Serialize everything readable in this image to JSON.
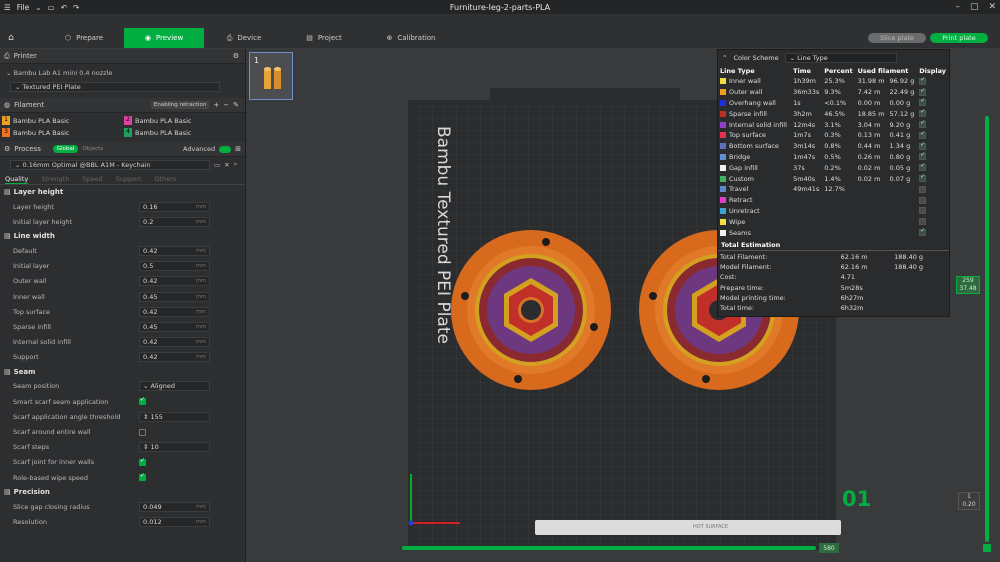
{
  "titlebar": {
    "menu_label": "File",
    "title": "Furniture-leg-2-parts-PLA"
  },
  "topbar": {
    "tabs": [
      {
        "label": "Prepare"
      },
      {
        "label": "Preview"
      },
      {
        "label": "Device"
      },
      {
        "label": "Project"
      },
      {
        "label": "Calibration"
      }
    ],
    "slice_label": "Slice plate",
    "print_label": "Print plate"
  },
  "printer": {
    "section_label": "Printer",
    "name": "Bambu Lab A1 mini 0.4 nozzle",
    "plate": "Textured PEI Plate"
  },
  "filament": {
    "section_label": "Filament",
    "badge": "Enabling retraction",
    "slots": [
      {
        "num": "1",
        "name": "Bambu PLA Basic",
        "color": "#f0a020"
      },
      {
        "num": "2",
        "name": "Bambu PLA Basic",
        "color": "#e040a0"
      },
      {
        "num": "3",
        "name": "Bambu PLA Basic",
        "color": "#f07020"
      },
      {
        "num": "4",
        "name": "Bambu PLA Basic",
        "color": "#20a060"
      }
    ]
  },
  "process": {
    "section_label": "Process",
    "global_label": "Global",
    "objects_label": "Objects",
    "advanced_label": "Advanced",
    "preset": "0.16mm Optimal @BBL A1M - Keychain",
    "tabs": [
      "Quality",
      "Strength",
      "Speed",
      "Support",
      "Others"
    ]
  },
  "quality": {
    "layer_height_group": "Layer height",
    "layer_height_label": "Layer height",
    "layer_height": "0.16",
    "initial_layer_height_label": "Initial layer height",
    "initial_layer_height": "0.2",
    "line_width_group": "Line width",
    "default_label": "Default",
    "default": "0.42",
    "initial_layer_label": "Initial layer",
    "initial_layer": "0.5",
    "outer_wall_label": "Outer wall",
    "outer_wall": "0.42",
    "inner_wall_label": "Inner wall",
    "inner_wall": "0.45",
    "top_surface_label": "Top surface",
    "top_surface": "0.42",
    "sparse_infill_label": "Sparse infill",
    "sparse_infill": "0.45",
    "internal_solid_infill_label": "Internal solid infill",
    "internal_solid_infill": "0.42",
    "support_label": "Support",
    "support": "0.42",
    "seam_group": "Seam",
    "seam_position_label": "Seam position",
    "seam_position": "Aligned",
    "smart_scarf_label": "Smart scarf seam application",
    "scarf_angle_label": "Scarf application angle threshold",
    "scarf_angle": "155",
    "scarf_around_label": "Scarf around entire wall",
    "scarf_steps_label": "Scarf steps",
    "scarf_steps": "10",
    "scarf_inner_label": "Scarf joint for inner walls",
    "role_wipe_label": "Role-based wipe speed",
    "precision_group": "Precision",
    "slice_gap_label": "Slice gap closing radius",
    "slice_gap": "0.049",
    "resolution_label": "Resolution",
    "resolution": "0.012",
    "unit": "mm"
  },
  "plate": {
    "thumb_num": "1",
    "bed_text": "Bambu Textured PEI Plate"
  },
  "legend": {
    "color_scheme_label": "Color Scheme",
    "color_scheme_value": "Line Type",
    "headers": [
      "Line Type",
      "Time",
      "Percent",
      "Used filament",
      "",
      "Display"
    ],
    "rows": [
      {
        "name": "Inner wall",
        "color": "#f0dc3c",
        "time": "1h39m",
        "pct": "25.3%",
        "len": "31.98 m",
        "g": "96.92 g",
        "on": true
      },
      {
        "name": "Outer wall",
        "color": "#f0a020",
        "time": "36m33s",
        "pct": "9.3%",
        "len": "7.42 m",
        "g": "22.49 g",
        "on": true
      },
      {
        "name": "Overhang wall",
        "color": "#2030d8",
        "time": "1s",
        "pct": "<0.1%",
        "len": "0.00 m",
        "g": "0.00 g",
        "on": true
      },
      {
        "name": "Sparse infill",
        "color": "#c03020",
        "time": "3h2m",
        "pct": "46.5%",
        "len": "18.85 m",
        "g": "57.12 g",
        "on": true
      },
      {
        "name": "Internal solid infill",
        "color": "#9040c8",
        "time": "12m4s",
        "pct": "3.1%",
        "len": "3.04 m",
        "g": "9.20 g",
        "on": true
      },
      {
        "name": "Top surface",
        "color": "#e83050",
        "time": "1m7s",
        "pct": "0.3%",
        "len": "0.13 m",
        "g": "0.41 g",
        "on": true
      },
      {
        "name": "Bottom surface",
        "color": "#6070b8",
        "time": "3m14s",
        "pct": "0.8%",
        "len": "0.44 m",
        "g": "1.34 g",
        "on": true
      },
      {
        "name": "Bridge",
        "color": "#6090d0",
        "time": "1m47s",
        "pct": "0.5%",
        "len": "0.26 m",
        "g": "0.80 g",
        "on": true
      },
      {
        "name": "Gap infill",
        "color": "#f0f0f0",
        "time": "37s",
        "pct": "0.2%",
        "len": "0.02 m",
        "g": "0.05 g",
        "on": true
      },
      {
        "name": "Custom",
        "color": "#40b060",
        "time": "5m40s",
        "pct": "1.4%",
        "len": "0.02 m",
        "g": "0.07 g",
        "on": true
      },
      {
        "name": "Travel",
        "color": "#6088c8",
        "time": "49m41s",
        "pct": "12.7%",
        "len": "",
        "g": "",
        "on": false
      },
      {
        "name": "Retract",
        "color": "#e040c0",
        "time": "",
        "pct": "",
        "len": "",
        "g": "",
        "on": false
      },
      {
        "name": "Unretract",
        "color": "#40a0d8",
        "time": "",
        "pct": "",
        "len": "",
        "g": "",
        "on": false
      },
      {
        "name": "Wipe",
        "color": "#f0e040",
        "time": "",
        "pct": "",
        "len": "",
        "g": "",
        "on": false
      },
      {
        "name": "Seams",
        "color": "#f0f0f0",
        "time": "",
        "pct": "",
        "len": "",
        "g": "",
        "on": true
      }
    ],
    "total_label": "Total Estimation",
    "totals": [
      {
        "label": "Total Filament:",
        "v1": "62.16 m",
        "v2": "188.40 g"
      },
      {
        "label": "Model Filament:",
        "v1": "62.16 m",
        "v2": "188.40 g"
      },
      {
        "label": "Cost:",
        "v1": "4.71",
        "v2": ""
      },
      {
        "label": "Prepare time:",
        "v1": "5m28s",
        "v2": ""
      },
      {
        "label": "Model printing time:",
        "v1": "6h27m",
        "v2": ""
      },
      {
        "label": "Total time:",
        "v1": "6h32m",
        "v2": ""
      }
    ]
  },
  "sliders": {
    "layer_top": "259",
    "layer_top_h": "37.48",
    "layer_bottom": "1",
    "layer_bottom_h": "0.20",
    "h_value": "580",
    "plate_number": "01"
  },
  "bottombar": {
    "surface_label": "HOT SURFACE"
  }
}
